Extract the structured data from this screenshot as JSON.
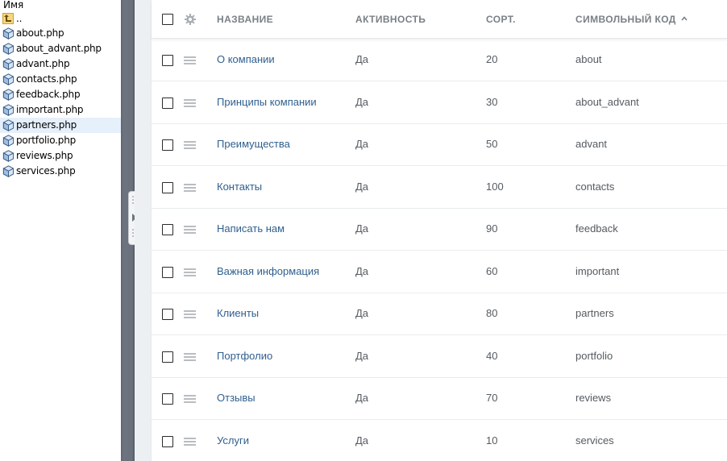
{
  "file_pane": {
    "header": "Имя",
    "up_label": "..",
    "files": [
      {
        "name": "about.php"
      },
      {
        "name": "about_advant.php"
      },
      {
        "name": "advant.php"
      },
      {
        "name": "contacts.php"
      },
      {
        "name": "feedback.php"
      },
      {
        "name": "important.php"
      },
      {
        "name": "partners.php",
        "selected": true
      },
      {
        "name": "portfolio.php"
      },
      {
        "name": "reviews.php"
      },
      {
        "name": "services.php"
      }
    ]
  },
  "table": {
    "columns": {
      "name": "НАЗВАНИЕ",
      "active": "АКТИВНОСТЬ",
      "sort": "СОРТ.",
      "code": "СИМВОЛЬНЫЙ КОД"
    },
    "sorted_column": "code",
    "sort_direction": "ascending",
    "rows": [
      {
        "name": "О компании",
        "active": "Да",
        "sort": "20",
        "code": "about"
      },
      {
        "name": "Принципы компании",
        "active": "Да",
        "sort": "30",
        "code": "about_advant"
      },
      {
        "name": "Преимущества",
        "active": "Да",
        "sort": "50",
        "code": "advant"
      },
      {
        "name": "Контакты",
        "active": "Да",
        "sort": "100",
        "code": "contacts"
      },
      {
        "name": "Написать нам",
        "active": "Да",
        "sort": "90",
        "code": "feedback"
      },
      {
        "name": "Важная информация",
        "active": "Да",
        "sort": "60",
        "code": "important"
      },
      {
        "name": "Клиенты",
        "active": "Да",
        "sort": "80",
        "code": "partners"
      },
      {
        "name": "Портфолио",
        "active": "Да",
        "sort": "40",
        "code": "portfolio"
      },
      {
        "name": "Отзывы",
        "active": "Да",
        "sort": "70",
        "code": "reviews"
      },
      {
        "name": "Услуги",
        "active": "Да",
        "sort": "10",
        "code": "services"
      }
    ]
  },
  "colors": {
    "link": "#2f5f8f",
    "header_text": "#7a8086",
    "cell_text": "#555b61",
    "splitter": "#6a717c",
    "gutter": "#edf0f2",
    "selected_file": "#e5f0fb"
  },
  "icons": {
    "file": "php-file-icon",
    "up": "up-folder-icon",
    "settings": "gear-icon",
    "drag": "drag-handle-icon",
    "sort": "sort-ascending-icon",
    "collapse": "collapse-arrow-icon"
  }
}
